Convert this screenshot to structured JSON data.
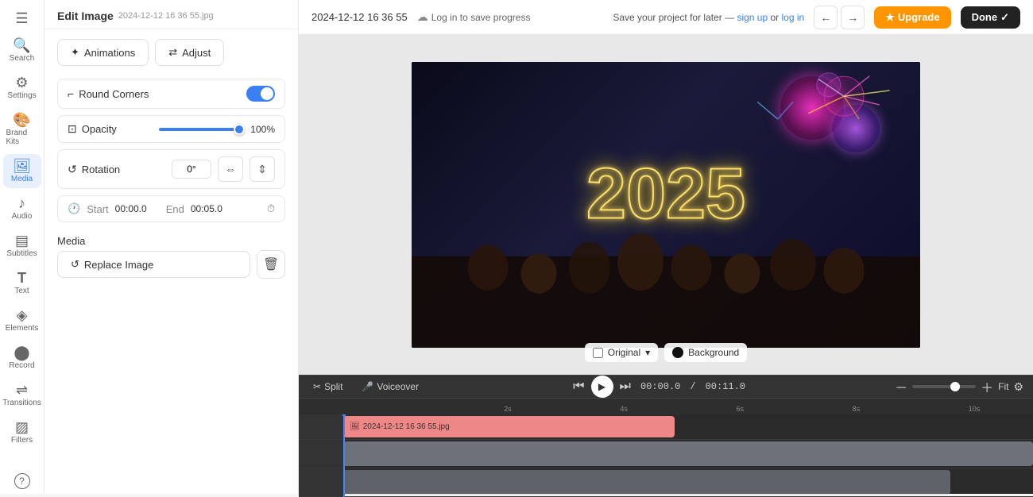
{
  "app": {
    "title": "Edit Image",
    "filename": "2024-12-12 16 36 55.jpg"
  },
  "topbar": {
    "timestamp": "2024-12-12 16 36 55",
    "save_notice": "Log in to save progress",
    "save_later_text": "Save your project for later —",
    "sign_up_text": "sign up",
    "or_text": "or",
    "log_in_text": "log in",
    "upgrade_label": "Upgrade",
    "done_label": "Done"
  },
  "panel": {
    "animations_tab": "Animations",
    "adjust_tab": "Adjust",
    "round_corners_label": "Round Corners",
    "opacity_label": "Opacity",
    "opacity_value": "100%",
    "rotation_label": "Rotation",
    "rotation_value": "0°",
    "start_label": "Start",
    "start_value": "00:00.0",
    "end_label": "End",
    "end_value": "00:05.0",
    "media_section": "Media",
    "replace_image_label": "Replace Image"
  },
  "canvas": {
    "original_label": "Original",
    "background_label": "Background"
  },
  "timeline": {
    "split_label": "Split",
    "voiceover_label": "Voiceover",
    "current_time": "00:00.0",
    "separator": "/",
    "total_time": "00:11.0",
    "fit_label": "Fit",
    "clip_name": "2024-12-12 16 36 55.jpg"
  },
  "ruler": {
    "marks": [
      "2s",
      "4s",
      "6s",
      "8s",
      "10s"
    ]
  },
  "nav": {
    "items": [
      {
        "id": "menu",
        "icon": "☰",
        "label": ""
      },
      {
        "id": "search",
        "icon": "🔍",
        "label": "Search"
      },
      {
        "id": "settings",
        "icon": "⚙",
        "label": "Settings"
      },
      {
        "id": "brand",
        "icon": "🎨",
        "label": "Brand Kits"
      },
      {
        "id": "media",
        "icon": "🖼",
        "label": "Media"
      },
      {
        "id": "audio",
        "icon": "♪",
        "label": "Audio"
      },
      {
        "id": "subtitles",
        "icon": "▤",
        "label": "Subtitles"
      },
      {
        "id": "text",
        "icon": "T",
        "label": "Text"
      },
      {
        "id": "elements",
        "icon": "◈",
        "label": "Elements"
      },
      {
        "id": "record",
        "icon": "⬤",
        "label": "Record"
      },
      {
        "id": "transitions",
        "icon": "⇌",
        "label": "Transitions"
      },
      {
        "id": "filters",
        "icon": "▨",
        "label": "Filters"
      },
      {
        "id": "help",
        "icon": "?",
        "label": ""
      }
    ]
  }
}
